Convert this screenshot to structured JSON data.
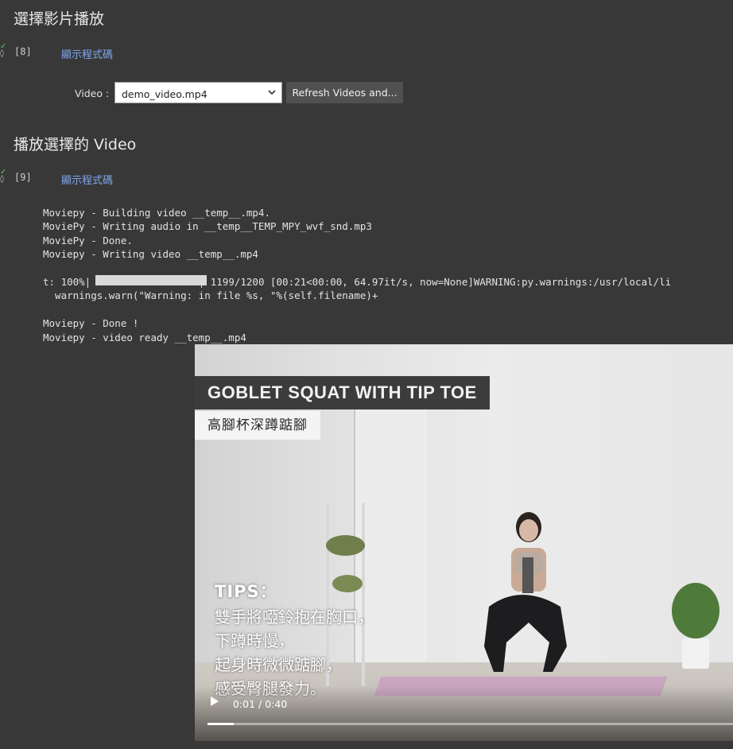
{
  "sections": [
    {
      "heading": "選擇影片播放"
    },
    {
      "heading": "播放選擇的 Video"
    }
  ],
  "cells": [
    {
      "number": "[8]",
      "show_code": "顯示程式碼"
    },
    {
      "number": "[9]",
      "show_code": "顯示程式碼"
    }
  ],
  "widget": {
    "label": "Video :",
    "selected": "demo_video.mp4",
    "refresh_label": "Refresh Videos and..."
  },
  "log": {
    "lines_a": "Moviepy - Building video __temp__.mp4.\nMoviePy - Writing audio in __temp__TEMP_MPY_wvf_snd.mp3\nMoviePy - Done.\nMoviepy - Writing video __temp__.mp4",
    "progress_prefix": "t: 100%|",
    "progress_suffix": "| 1199/1200 [00:21<00:00, 64.97it/s, now=None]WARNING:py.warnings:/usr/local/li",
    "warn_line": "  warnings.warn(\"Warning: in file %s, \"%(self.filename)+",
    "lines_b": "Moviepy - Done !\nMoviepy - video ready __temp__.mp4",
    "progress_fraction": 1.0
  },
  "video": {
    "title_en": "GOBLET SQUAT WITH TIP TOE",
    "title_zh": "高腳杯深蹲踮腳",
    "tips_head": "TIPS：",
    "tips": [
      "雙手將啞鈴抱在胸口，",
      "下蹲時慢，",
      "起身時微微踮腳，",
      "感受臀腿發力。"
    ],
    "time": "0:01 / 0:40",
    "played_fraction": 0.05,
    "icon": "play-icon"
  }
}
